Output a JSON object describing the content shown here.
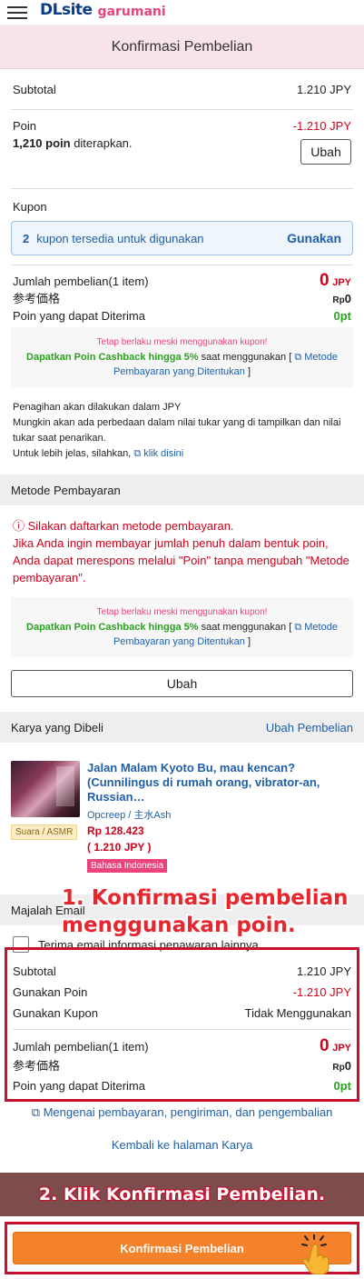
{
  "header": {
    "logo": "DLsite",
    "logo_sub": "garumani"
  },
  "page_title": "Konfirmasi Pembelian",
  "summary": {
    "subtotal_label": "Subtotal",
    "subtotal_value": "1.210 JPY",
    "point_label": "Poin",
    "point_value": "-1.210 JPY",
    "point_applied_bold": "1,210 poin",
    "point_applied_text": " diterapkan.",
    "change_label": "Ubah",
    "coupon_label": "Kupon",
    "coupon_count": "2",
    "coupon_text": "kupon tersedia untuk digunakan",
    "coupon_use": "Gunakan",
    "total_label": "Jumlah pembelian(1 item)",
    "total_value": "0",
    "total_unit": "JPY",
    "ref_label": "参考価格",
    "ref_currency": "Rp",
    "ref_value": "0",
    "receive_label": "Poin yang dapat Diterima",
    "receive_value": "0pt"
  },
  "cashback": {
    "note": "Tetap berlaku meski menggunakan kupon!",
    "strong": "Dapatkan Poin Cashback hingga 5%",
    "text": " saat menggunakan [ ",
    "link": "Metode Pembayaran yang Ditentukan",
    "end": " ]"
  },
  "billing": {
    "line1": "Penagihan akan dilakukan dalam JPY",
    "line2": "Mungkin akan ada perbedaan dalam nilai tukar yang di tampilkan dan nilai tukar saat penarikan.",
    "line3": "Untuk lebih jelas, silahkan,",
    "link": "klik disini"
  },
  "payment": {
    "head": "Metode Pembayaran",
    "warn1": "Silakan daftarkan metode pembayaran.",
    "warn2": "Jika Anda ingin membayar jumlah penuh dalam bentuk poin, Anda dapat merespons melalui \"Poin\" tanpa mengubah \"Metode pembayaran\".",
    "change": "Ubah"
  },
  "works": {
    "head": "Karya yang Dibeli",
    "edit": "Ubah Pembelian",
    "title": "Jalan Malam Kyoto Bu, mau kencan? (Cunnilingus di rumah orang, vibrator-an, Russian…",
    "circle": "Opcreep",
    "circle_sep": "/",
    "cv": "主水Ash",
    "price_line1": "Rp 128.423",
    "price_line2": "( 1.210 JPY )",
    "tag_type": "Suara / ASMR",
    "tag_lang": "Bahasa Indonesia"
  },
  "magazine": {
    "head": "Majalah Email",
    "label": "Terima email informasi penawaran lainnya"
  },
  "final": {
    "subtotal_label": "Subtotal",
    "subtotal_value": "1.210 JPY",
    "point_label": "Gunakan Poin",
    "point_value": "-1.210 JPY",
    "coupon_label": "Gunakan Kupon",
    "coupon_value": "Tidak Menggunakan",
    "total_label": "Jumlah pembelian(1 item)",
    "total_value": "0",
    "total_unit": "JPY",
    "ref_label": "参考価格",
    "ref_currency": "Rp",
    "ref_value": "0",
    "receive_label": "Poin yang dapat Diterima",
    "receive_value": "0pt"
  },
  "links": {
    "policy": "Mengenai pembayaran, pengiriman, dan pengembalian",
    "back": "Kembali ke halaman Karya"
  },
  "annotations": {
    "step1_line1": "1. Konfirmasi pembelian",
    "step1_line2": "menggunakan poin.",
    "step2": "2. Klik Konfirmasi Pembelian."
  },
  "confirm_button": "Konfirmasi Pembelian"
}
